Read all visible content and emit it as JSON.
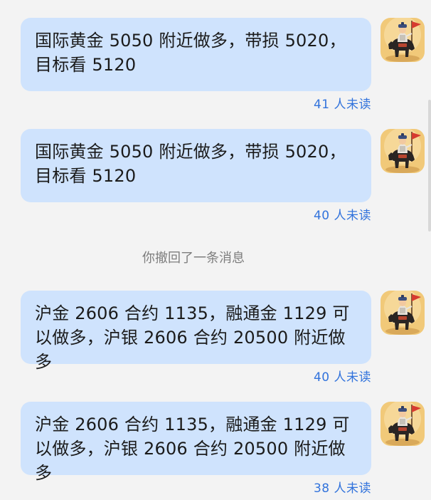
{
  "messages": [
    {
      "text": "国际黄金 5050 附近做多，带损 5020，目标看 5120",
      "read_status": "41 人未读"
    },
    {
      "text": "国际黄金 5050 附近做多，带损 5020，目标看 5120",
      "read_status": "40 人未读"
    },
    {
      "text": "沪金 2606 合约 1135，融通金 1129 可以做多，沪银 2606 合约 20500 附近做多",
      "read_status": "40 人未读"
    },
    {
      "text": "沪金 2606 合约 1135，融通金 1129 可以做多，沪银 2606 合约 20500 附近做多",
      "read_status": "38 人未读"
    }
  ],
  "recall_notice": "你撤回了一条消息",
  "colors": {
    "background": "#f3f3f3",
    "bubble": "#cfe3fd",
    "read_status": "#3273dc",
    "notice": "#7d7d7d"
  },
  "avatar_icon": "horse-rider-avatar-icon"
}
